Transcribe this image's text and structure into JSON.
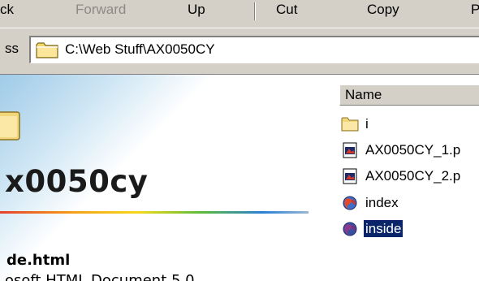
{
  "toolbar": {
    "back_label": "ck",
    "forward_label": "Forward",
    "up_label": "Up",
    "cut_label": "Cut",
    "copy_label": "Copy",
    "paste_label": "P"
  },
  "address": {
    "label": "ss",
    "path": "C:\\Web Stuff\\AX0050CY"
  },
  "webview": {
    "title": "x0050cy",
    "file_name": "de.html",
    "file_type": "osoft HTML Document 5.0"
  },
  "file_list": {
    "column_name": "Name",
    "items": [
      {
        "label": "i",
        "icon": "folder-icon",
        "selected": false
      },
      {
        "label": "AX0050CY_1.p",
        "icon": "image-file-icon",
        "selected": false
      },
      {
        "label": "AX0050CY_2.p",
        "icon": "image-file-icon",
        "selected": false
      },
      {
        "label": "index",
        "icon": "html-file-icon",
        "selected": false
      },
      {
        "label": "inside",
        "icon": "html-file-icon",
        "selected": true
      }
    ]
  },
  "colors": {
    "chrome": "#d4d0c8",
    "selection": "#0a246a",
    "disabled_text": "#8d8a84"
  }
}
